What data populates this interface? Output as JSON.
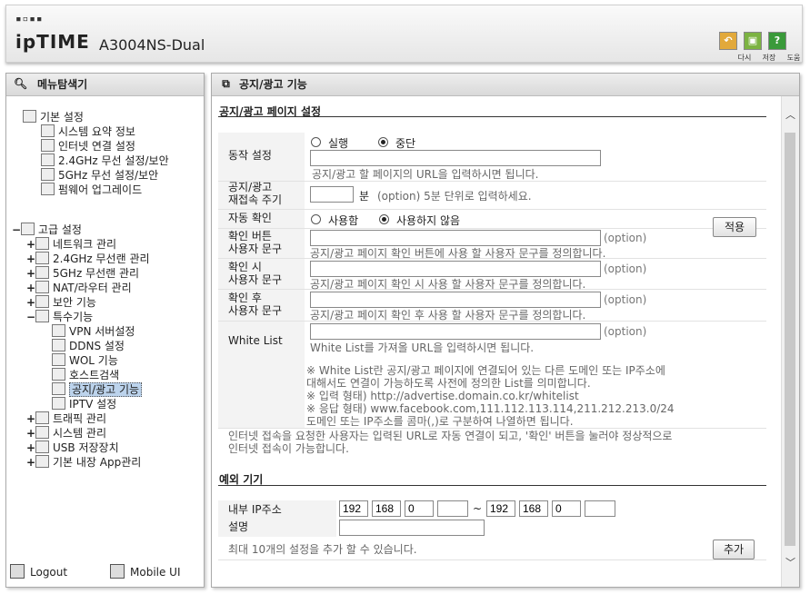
{
  "header": {
    "logo_dots": "▪▫▪▪",
    "brand": "ipTIME",
    "model": "A3004NS-Dual",
    "buttons": [
      {
        "label": "다시",
        "icon": "undo-icon",
        "color": "#e2a93b"
      },
      {
        "label": "저장",
        "icon": "save-icon",
        "color": "#7cb342"
      },
      {
        "label": "도움",
        "icon": "help-icon",
        "color": "#3a9a3a",
        "glyph": "?"
      }
    ]
  },
  "left": {
    "title": "메뉴탐색기",
    "basic": {
      "label": "기본 설정",
      "items": [
        "시스템 요약 정보",
        "인터넷 연결 설정",
        "2.4GHz 무선 설정/보안",
        "5GHz 무선 설정/보안",
        "펌웨어 업그레이드"
      ]
    },
    "advanced": {
      "label": "고급 설정",
      "items": [
        "네트워크 관리",
        "2.4GHz 무선랜 관리",
        "5GHz 무선랜 관리",
        "NAT/라우터 관리",
        "보안 기능",
        "특수기능"
      ],
      "special": [
        "VPN 서버설정",
        "DDNS 설정",
        "WOL 기능",
        "호스트검색",
        "공지/광고 기능",
        "IPTV 설정"
      ],
      "more": [
        "트래픽 관리",
        "시스템 관리",
        "USB 저장장치",
        "기본 내장 App관리"
      ]
    },
    "logout": "Logout",
    "mobile": "Mobile UI"
  },
  "right": {
    "title": "공지/광고 기능",
    "section1": "공지/광고 페이지 설정",
    "action": {
      "label": "동작 설정",
      "run": "실행",
      "stop": "중단",
      "url_value": "",
      "hint": "공지/광고 할 페이지의 URL을 입력하시면 됩니다."
    },
    "reconnect": {
      "label1": "공지/광고",
      "label2": "재접속 주기",
      "value": "",
      "unit": "분",
      "hint": "(option) 5분 단위로 입력하세요."
    },
    "autocheck": {
      "label": "자동 확인",
      "use": "사용함",
      "nouse": "사용하지 않음"
    },
    "confirm_btn": {
      "label1": "확인 버튼",
      "label2": "사용자 문구",
      "value": "",
      "opt": "(option)",
      "hint": "공지/광고 페이지 확인 버튼에 사용 할 사용자 문구를 정의합니다."
    },
    "confirm_when": {
      "label1": "확인 시",
      "label2": "사용자 문구",
      "value": "",
      "opt": "(option)",
      "hint": "공지/광고 페이지 확인 시 사용 할 사용자 문구를 정의합니다."
    },
    "confirm_after": {
      "label1": "확인 후",
      "label2": "사용자 문구",
      "value": "",
      "opt": "(option)",
      "hint": "공지/광고 페이지 확인 후 사용 할 사용자 문구를 정의합니다."
    },
    "whitelist": {
      "label": "White List",
      "value": "",
      "opt": "(option)",
      "hint": "White List를 가져올 URL을 입력하시면 됩니다.",
      "notes": [
        "※ White List란 공지/광고 페이지에 연결되어 있는 다른 도메인 또는 IP주소에",
        "    대해서도 연결이 가능하도록 사전에 정의한 List를 의미합니다.",
        "※ 입력 형태) http://advertise.domain.co.kr/whitelist",
        "※ 응답 형태) www.facebook.com,111.112.113.114,211.212.213.0/24",
        "    도메인 또는 IP주소를 콤마(,)로 구분하여 나열하면 됩니다."
      ]
    },
    "summary1": "인터넷 접속을 요청한 사용자는 입력된 URL로 자동 연결이 되고, '확인' 버튼을 눌러야 정상적으로",
    "summary2": "인터넷 접속이 가능합니다.",
    "apply": "적용",
    "section2": "예외 기기",
    "internal_ip": "내부 IP주소",
    "ip_from": [
      "192",
      "168",
      "0",
      ""
    ],
    "ip_to": [
      "192",
      "168",
      "0",
      ""
    ],
    "tilde": "~",
    "desc": "설명",
    "desc_value": "",
    "max_note": "최대 10개의 설정을 추가 할 수 있습니다.",
    "add": "추가"
  }
}
